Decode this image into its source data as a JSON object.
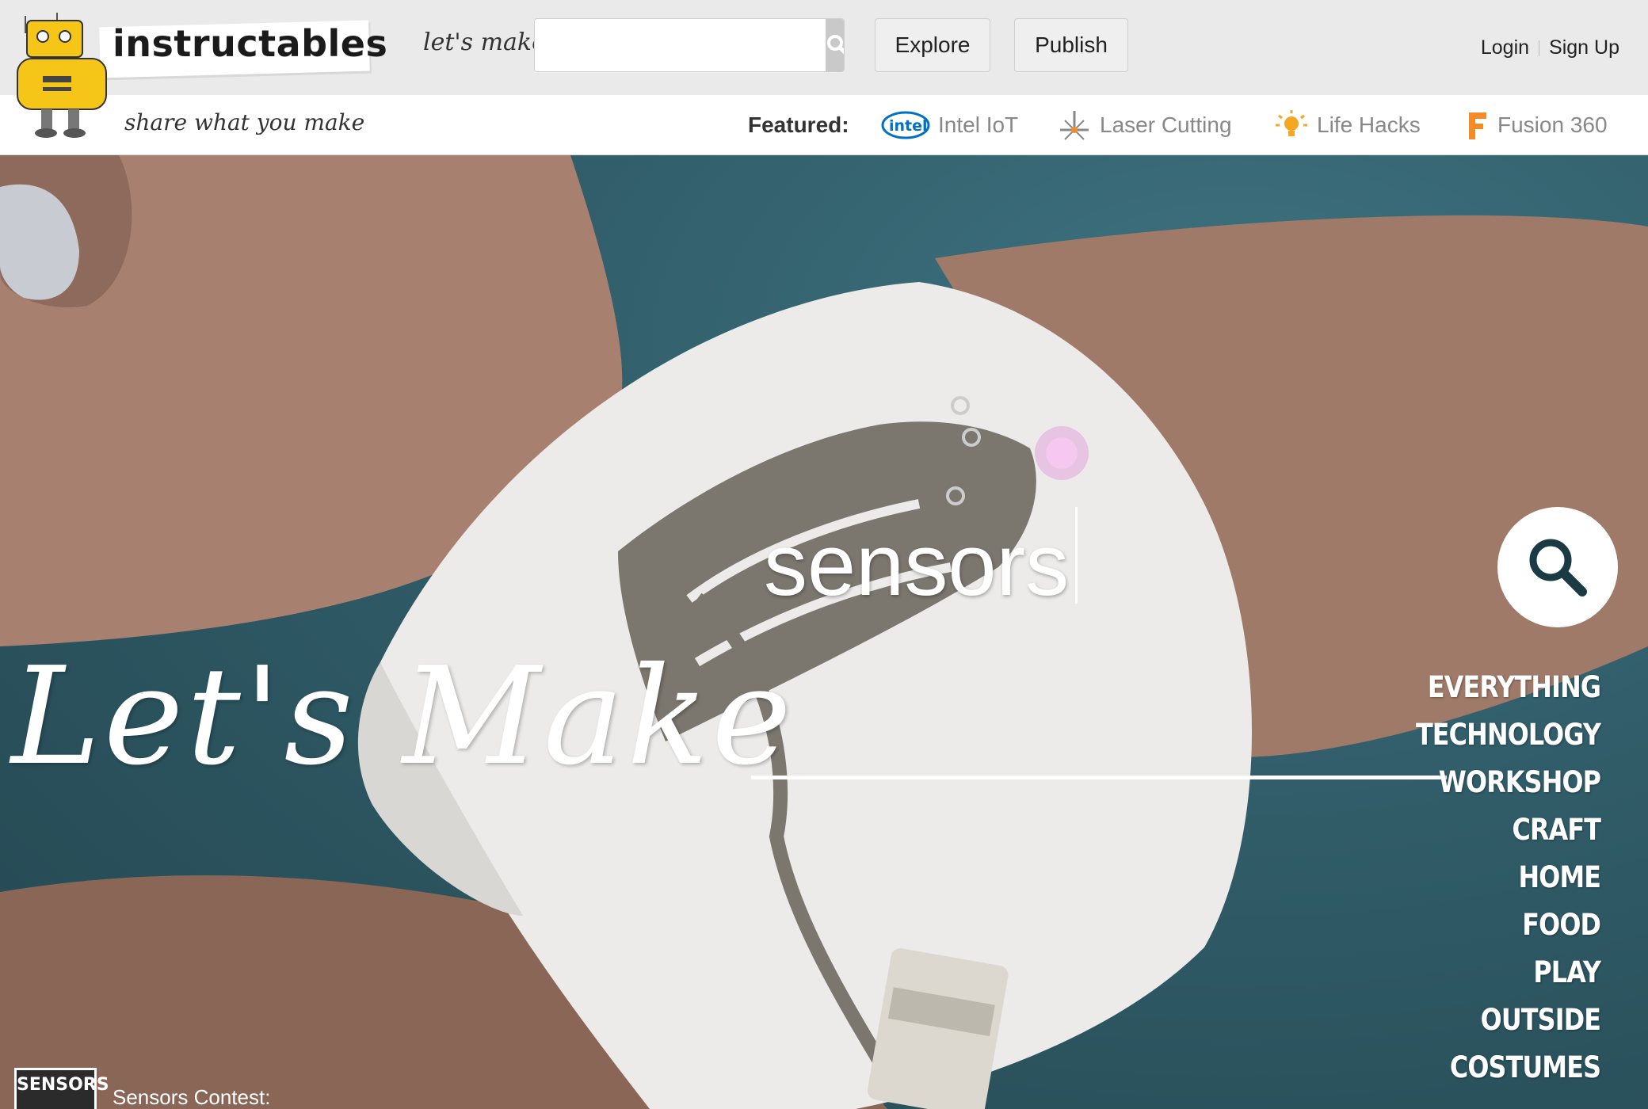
{
  "header": {
    "logo_text": "instructables",
    "tagline": "share what you make",
    "lets_make_label": "let's make",
    "search": {
      "placeholder": "",
      "value": ""
    },
    "explore_label": "Explore",
    "publish_label": "Publish",
    "login_label": "Login",
    "signup_label": "Sign Up"
  },
  "featured": {
    "label": "Featured:",
    "items": [
      {
        "label": "Intel IoT",
        "icon": "intel-logo-icon"
      },
      {
        "label": "Laser Cutting",
        "icon": "laser-icon"
      },
      {
        "label": "Life Hacks",
        "icon": "lightbulb-icon"
      },
      {
        "label": "Fusion 360",
        "icon": "fusion-logo-icon"
      }
    ]
  },
  "hero": {
    "headline": "Let's Make",
    "query": "sensors",
    "categories": [
      "EVERYTHING",
      "TECHNOLOGY",
      "WORKSHOP",
      "CRAFT",
      "HOME",
      "FOOD",
      "PLAY",
      "OUTSIDE",
      "COSTUMES"
    ]
  },
  "contest": {
    "badge": "SENSORS",
    "label": "Sensors Contest:"
  },
  "colors": {
    "header_bg": "#eaeaea",
    "robot_yellow": "#f5c518",
    "search_button": "#c9c9c9",
    "fusion_orange": "#f28c28",
    "intel_blue": "#0071c5"
  }
}
